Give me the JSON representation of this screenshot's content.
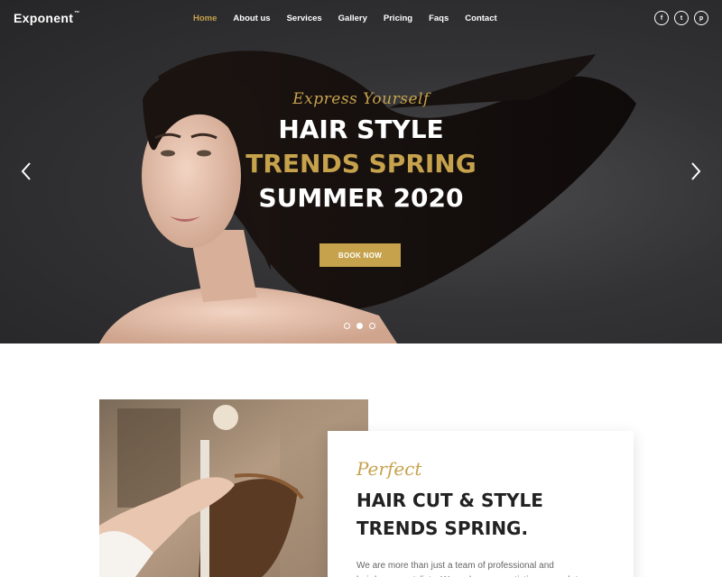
{
  "brand": {
    "name": "Exponent",
    "mark": "™"
  },
  "nav": {
    "items": [
      {
        "label": "Home",
        "active": true
      },
      {
        "label": "About us"
      },
      {
        "label": "Services"
      },
      {
        "label": "Gallery"
      },
      {
        "label": "Pricing"
      },
      {
        "label": "Faqs"
      },
      {
        "label": "Contact"
      }
    ],
    "social": [
      {
        "icon": "facebook-icon",
        "glyph": "f"
      },
      {
        "icon": "twitter-icon",
        "glyph": "t"
      },
      {
        "icon": "pinterest-icon",
        "glyph": "p"
      }
    ]
  },
  "hero": {
    "script": "Express Yourself",
    "line1": "HAIR STYLE",
    "line2": "TRENDS SPRING",
    "line3": "SUMMER 2020",
    "button": "BOOK NOW",
    "slide_count": 3,
    "active_slide": 2
  },
  "feature": {
    "script": "Perfect",
    "heading1": "HAIR CUT & STYLE",
    "heading2": "TRENDS SPRING.",
    "body": "We are more than just a team of professional and hairdressers stylists. We embrace an artistic approach to our every client."
  },
  "colors": {
    "accent": "#c6a24d",
    "dark": "#2c2c2e",
    "text": "#222222",
    "muted": "#666666"
  }
}
